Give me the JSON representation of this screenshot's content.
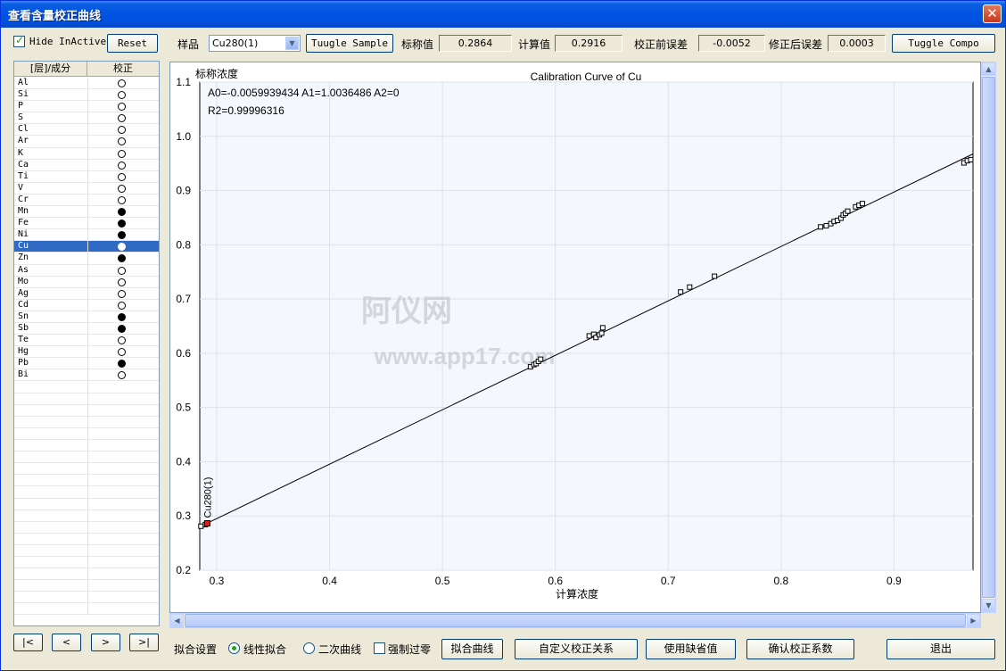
{
  "window": {
    "title": "查看含量校正曲线",
    "close_glyph": "✕"
  },
  "toolbar": {
    "hide_inactive_label": "Hide InActive",
    "hide_inactive_checked": true,
    "reset_label": "Reset",
    "sample_label": "样品",
    "sample_value": "Cu280(1)",
    "tuggle_sample_label": "Tuugle Sample",
    "nominal_label": "标称值",
    "nominal_value": "0.2864",
    "calc_label": "计算值",
    "calc_value": "0.2916",
    "err_before_label": "校正前误差",
    "err_before_value": "-0.0052",
    "err_after_label": "修正后误差",
    "err_after_value": "0.0003",
    "tuggle_compo_label": "Tuggle Compo"
  },
  "element_list": {
    "header_layer": "[层]/成分",
    "header_correct": "校正",
    "items": [
      {
        "name": "Al",
        "on": false
      },
      {
        "name": "Si",
        "on": false
      },
      {
        "name": "P",
        "on": false
      },
      {
        "name": "S",
        "on": false
      },
      {
        "name": "Cl",
        "on": false
      },
      {
        "name": "Ar",
        "on": false
      },
      {
        "name": "K",
        "on": false
      },
      {
        "name": "Ca",
        "on": false
      },
      {
        "name": "Ti",
        "on": false
      },
      {
        "name": "V",
        "on": false
      },
      {
        "name": "Cr",
        "on": false
      },
      {
        "name": "Mn",
        "on": true
      },
      {
        "name": "Fe",
        "on": true
      },
      {
        "name": "Ni",
        "on": true
      },
      {
        "name": "Cu",
        "on": true,
        "selected": true
      },
      {
        "name": "Zn",
        "on": true
      },
      {
        "name": "As",
        "on": false
      },
      {
        "name": "Mo",
        "on": false
      },
      {
        "name": "Ag",
        "on": false
      },
      {
        "name": "Cd",
        "on": false
      },
      {
        "name": "Sn",
        "on": true
      },
      {
        "name": "Sb",
        "on": true
      },
      {
        "name": "Te",
        "on": false
      },
      {
        "name": "Hg",
        "on": false
      },
      {
        "name": "Pb",
        "on": true
      },
      {
        "name": "Bi",
        "on": false
      }
    ]
  },
  "nav": {
    "first": "|<",
    "prev": "<",
    "next": ">",
    "last": ">|"
  },
  "bottom": {
    "fit_settings_label": "拟合设置",
    "linear_label": "线性拟合",
    "quadratic_label": "二次曲线",
    "force_zero_label": "强制过零",
    "fit_curve_label": "拟合曲线",
    "custom_label": "自定义校正关系",
    "default_label": "使用缺省值",
    "confirm_label": "确认校正系数",
    "exit_label": "退出"
  },
  "watermark": {
    "line1": "阿仪网",
    "line2": "www.app17.com"
  },
  "colors": {
    "selected_row": "#316ac5",
    "highlight_point": "#d62020",
    "plot_bg": "#f4f8fd"
  },
  "chart_data": {
    "type": "scatter",
    "title": "Calibration Curve of Cu",
    "xlabel": "计算浓度",
    "ylabel": "标称浓度",
    "xlim": [
      0.285,
      0.97
    ],
    "ylim": [
      0.2,
      1.1
    ],
    "xticks": [
      "0.3",
      "0.4",
      "0.5",
      "0.6",
      "0.7",
      "0.8",
      "0.9"
    ],
    "yticks": [
      "0.2",
      "0.3",
      "0.4",
      "0.5",
      "0.6",
      "0.7",
      "0.8",
      "0.9",
      "1.0",
      "1.1"
    ],
    "grid": true,
    "equation": "A0=-0.0059939434  A1=1.0036486  A2=0",
    "r2": "R2=0.99996316",
    "fit": {
      "a0": -0.0059939434,
      "a1": 1.0036486
    },
    "highlight_label": "Cu280(1)",
    "highlight_point": {
      "x": 0.2916,
      "y": 0.2864
    },
    "points": [
      [
        0.286,
        0.281
      ],
      [
        0.29,
        0.284
      ],
      [
        0.292,
        0.287
      ],
      [
        0.578,
        0.575
      ],
      [
        0.581,
        0.579
      ],
      [
        0.583,
        0.581
      ],
      [
        0.585,
        0.585
      ],
      [
        0.587,
        0.589
      ],
      [
        0.63,
        0.632
      ],
      [
        0.634,
        0.635
      ],
      [
        0.636,
        0.629
      ],
      [
        0.639,
        0.634
      ],
      [
        0.641,
        0.637
      ],
      [
        0.642,
        0.647
      ],
      [
        0.711,
        0.713
      ],
      [
        0.719,
        0.722
      ],
      [
        0.741,
        0.742
      ],
      [
        0.835,
        0.833
      ],
      [
        0.84,
        0.835
      ],
      [
        0.844,
        0.839
      ],
      [
        0.847,
        0.843
      ],
      [
        0.85,
        0.845
      ],
      [
        0.853,
        0.849
      ],
      [
        0.855,
        0.855
      ],
      [
        0.857,
        0.858
      ],
      [
        0.859,
        0.862
      ],
      [
        0.866,
        0.87
      ],
      [
        0.869,
        0.873
      ],
      [
        0.872,
        0.876
      ],
      [
        0.962,
        0.951
      ],
      [
        0.965,
        0.955
      ],
      [
        0.968,
        0.957
      ]
    ]
  }
}
